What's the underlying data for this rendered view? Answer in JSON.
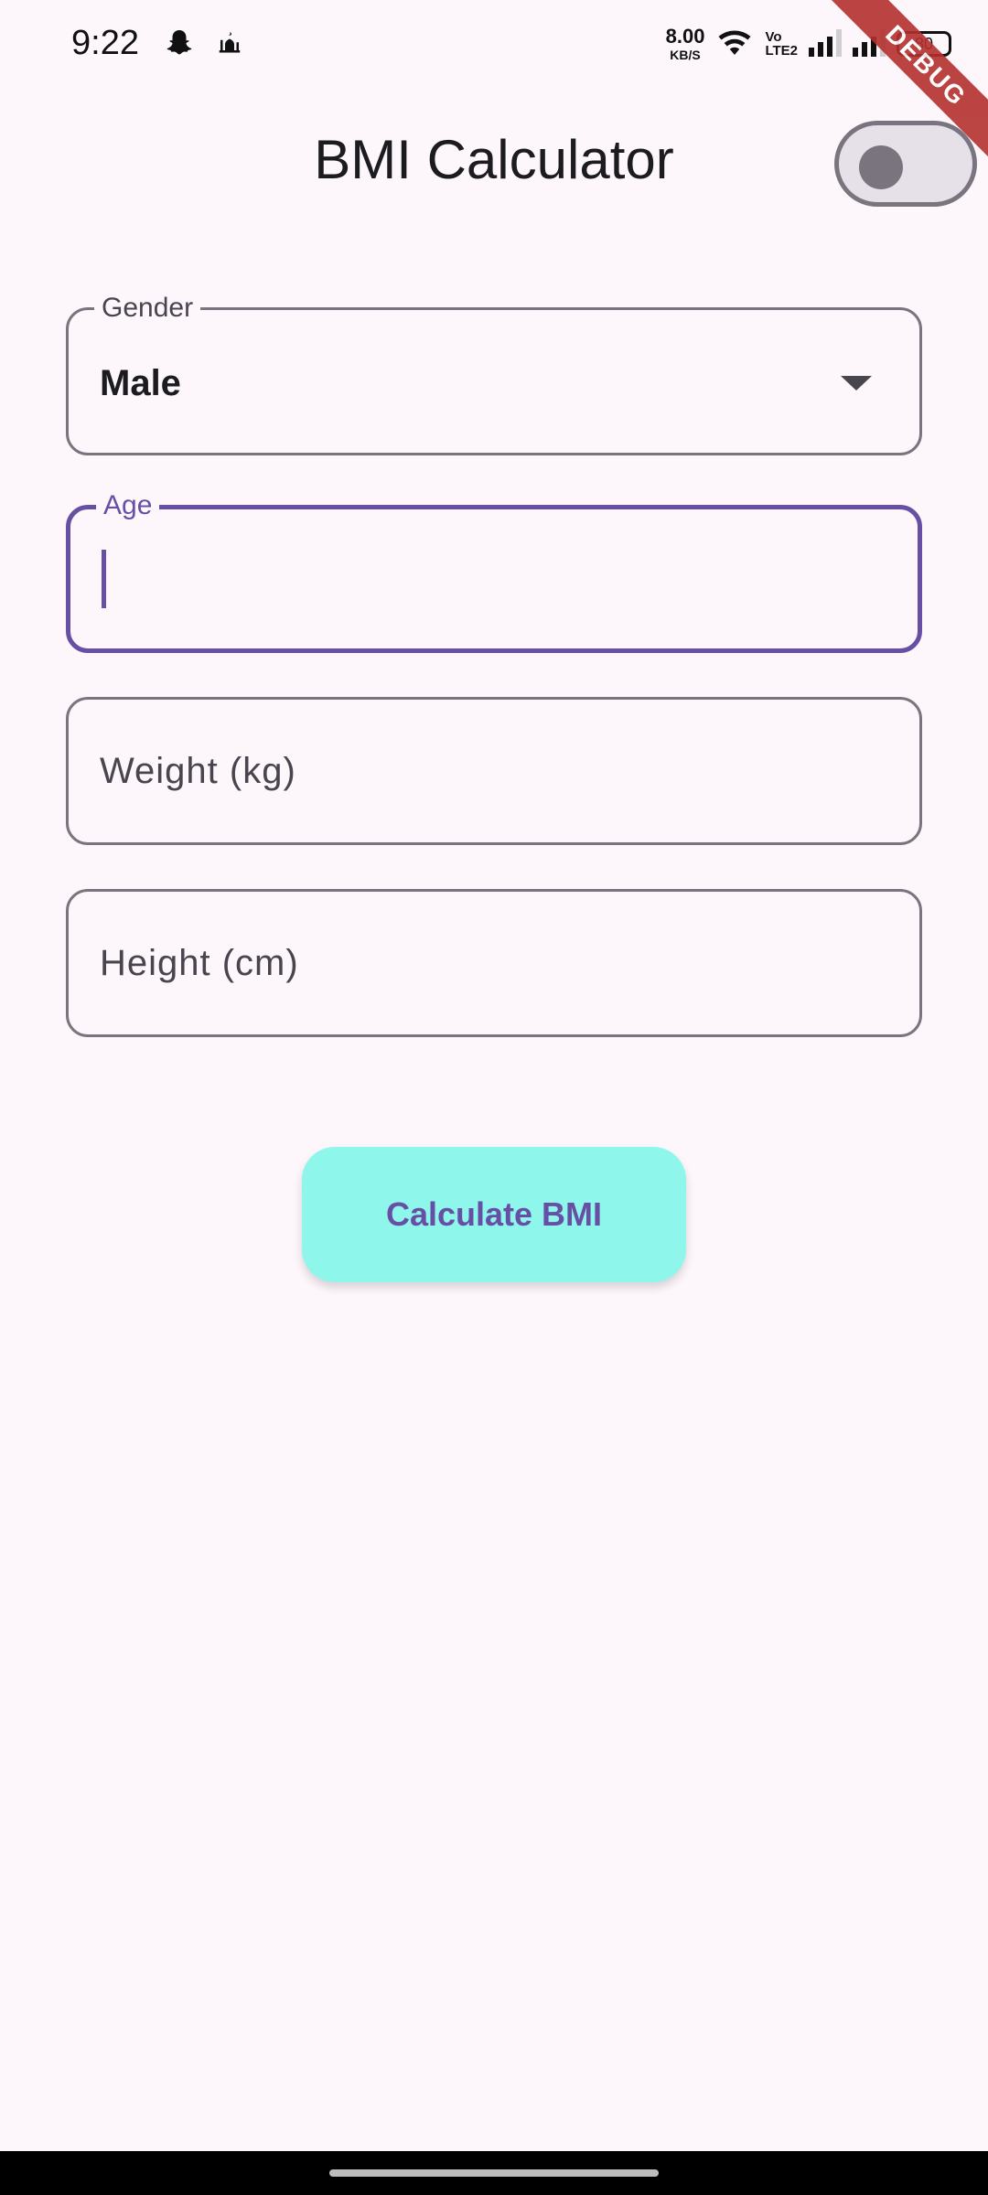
{
  "status_bar": {
    "time": "9:22",
    "net_speed_value": "8.00",
    "net_speed_unit": "KB/S",
    "volte_top": "Vo",
    "volte_bottom": "LTE2",
    "battery": "80",
    "left_icons": [
      "snapchat-icon",
      "mosque-icon"
    ],
    "right_icons": [
      "wifi-icon",
      "signal-icon",
      "signal-icon",
      "battery-icon"
    ]
  },
  "debug_banner": {
    "label": "DEBUG",
    "color": "#b4312f"
  },
  "app_bar": {
    "title": "BMI Calculator",
    "theme_toggle_on": false
  },
  "form": {
    "gender": {
      "label": "Gender",
      "value": "Male"
    },
    "age": {
      "label": "Age",
      "value": ""
    },
    "weight": {
      "placeholder": "Weight (kg)"
    },
    "height": {
      "placeholder": "Height (cm)"
    }
  },
  "calculate_button": {
    "label": "Calculate BMI"
  },
  "colors": {
    "primary": "#6750a4",
    "background": "#fdf7fc",
    "button_bg": "#8ff6ec",
    "outline": "#79747e"
  }
}
